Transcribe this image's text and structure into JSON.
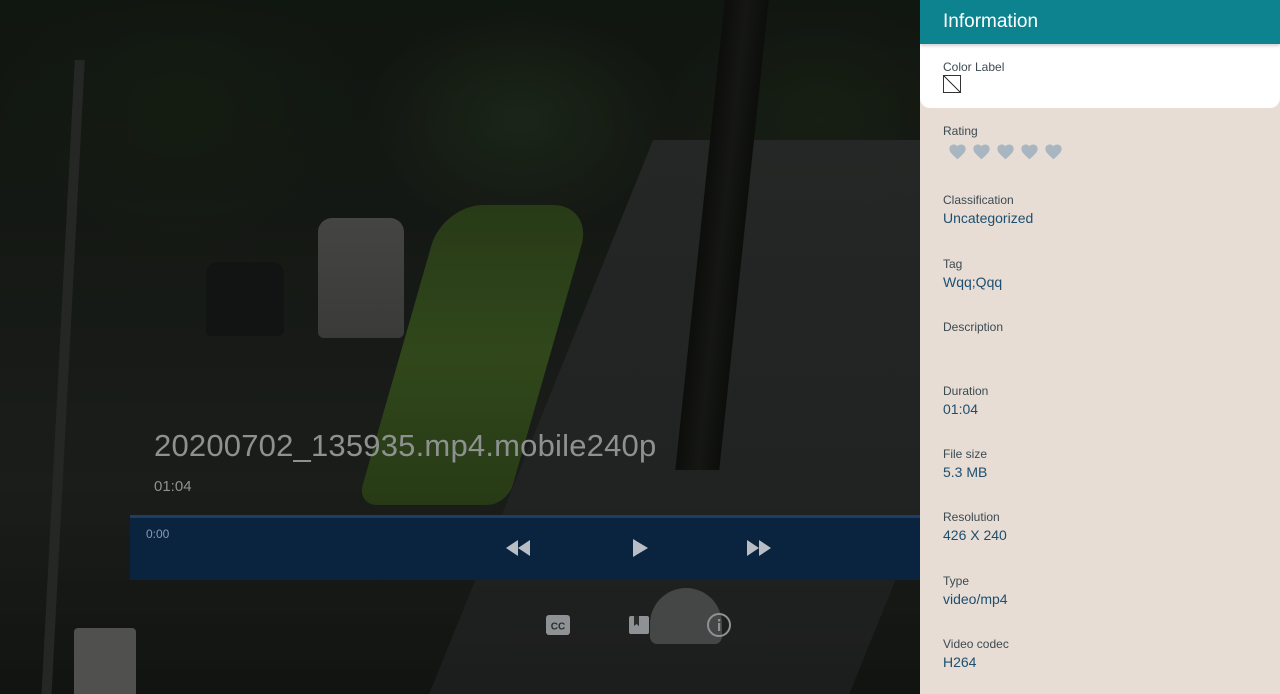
{
  "video": {
    "title": "20200702_135935.mp4.mobile240p",
    "duration_label": "01:04",
    "current_time": "0:00",
    "progress": 0
  },
  "controls": {
    "rewind_icon": "fast-rewind-icon",
    "play_icon": "play-icon",
    "forward_icon": "fast-forward-icon",
    "captions_icon": "closed-captions-icon",
    "chapters_icon": "bookmark-icon",
    "info_icon": "info-icon"
  },
  "info_panel": {
    "title": "Information",
    "header_color": "#0e8390",
    "panel_color": "#e7ddd4",
    "color_label": {
      "label": "Color Label",
      "icon": "no-color-swatch-icon"
    },
    "rating": {
      "label": "Rating",
      "value": 0,
      "max": 5,
      "icon": "heart-icon"
    },
    "fields": [
      {
        "label": "Classification",
        "value": "Uncategorized"
      },
      {
        "label": "Tag",
        "value": "Wqq;Qqq"
      },
      {
        "label": "Description",
        "value": ""
      },
      {
        "label": "Duration",
        "value": "01:04"
      },
      {
        "label": "File size",
        "value": "5.3 MB"
      },
      {
        "label": "Resolution",
        "value": "426 X 240"
      },
      {
        "label": "Type",
        "value": "video/mp4"
      },
      {
        "label": "Video codec",
        "value": "H264"
      }
    ]
  }
}
